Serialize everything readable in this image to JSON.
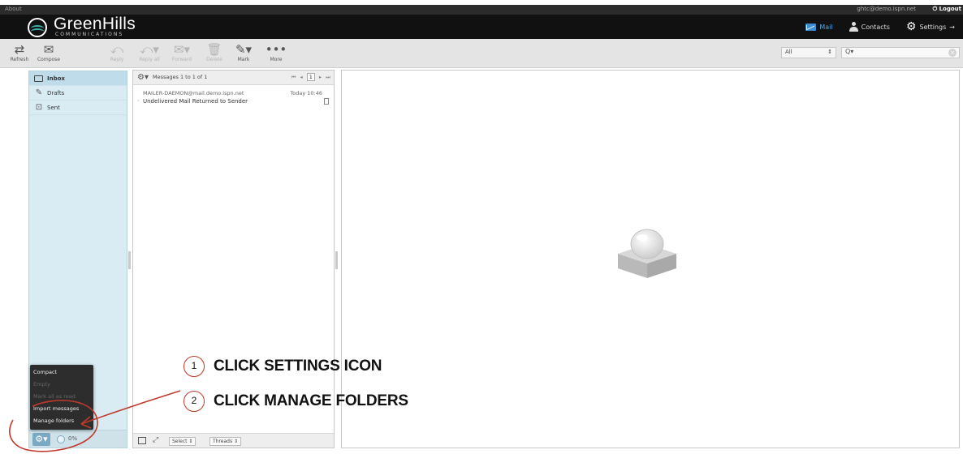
{
  "topbar": {
    "about": "About",
    "user_email": "ghtc@demo.ispn.net",
    "logout": "Logout"
  },
  "brand": {
    "name": "GreenHills",
    "sub": "COMMUNICATIONS"
  },
  "nav": {
    "mail": "Mail",
    "contacts": "Contacts",
    "settings": "Settings"
  },
  "toolbar": {
    "refresh": "Refresh",
    "compose": "Compose",
    "reply": "Reply",
    "reply_all": "Reply all",
    "forward": "Forward",
    "delete": "Delete",
    "mark": "Mark",
    "more": "More",
    "filter": "All",
    "search_placeholder": "Q▾"
  },
  "folders": {
    "items": [
      {
        "label": "Inbox"
      },
      {
        "label": "Drafts"
      },
      {
        "label": "Sent"
      }
    ],
    "quota": "0%"
  },
  "popup_menu": {
    "items": [
      {
        "label": "Compact"
      },
      {
        "label": "Empty"
      },
      {
        "label": "Mark all as read"
      },
      {
        "label": "Import messages"
      },
      {
        "label": "Manage folders"
      }
    ]
  },
  "message_list": {
    "header": "Messages 1 to 1 of 1",
    "page": "1",
    "messages": [
      {
        "from": "MAILER-DAEMON@mail.demo.ispn.net",
        "date": "Today 10:46",
        "subject": "Undelivered Mail Returned to Sender"
      }
    ],
    "footer": {
      "select": "Select",
      "threads": "Threads"
    }
  },
  "annotations": [
    {
      "number": "1",
      "text": "CLICK SETTINGS ICON"
    },
    {
      "number": "2",
      "text": "CLICK MANAGE FOLDERS"
    }
  ],
  "colors": {
    "header_bg": "#111111",
    "folder_pane": "#d9ecf4",
    "accent": "#3b8ed3",
    "annotation": "#c0392b"
  }
}
